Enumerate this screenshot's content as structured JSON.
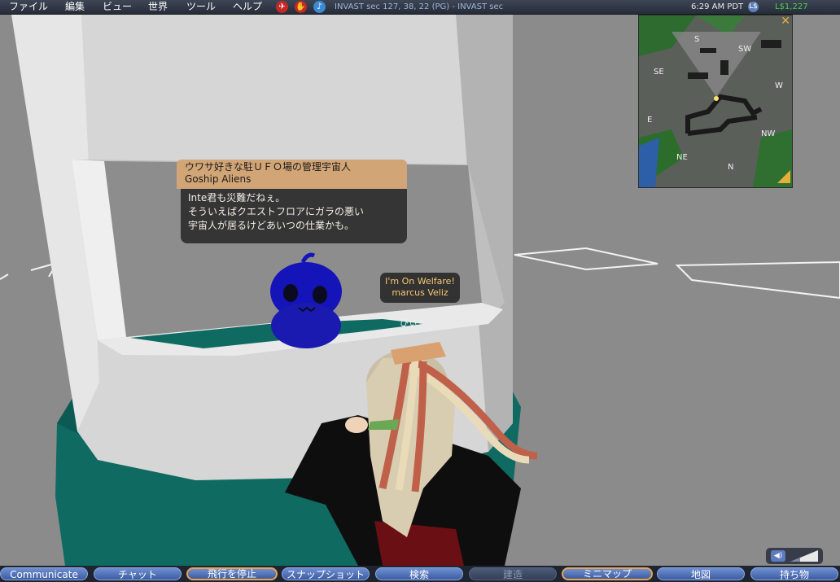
{
  "menubar": {
    "menus": [
      "ファイル",
      "編集",
      "ビュー",
      "世界",
      "ツール",
      "ヘルプ"
    ],
    "location": "INVAST sec 127, 38, 22 (PG) - INVAST sec",
    "time": "6:29 AM PDT",
    "buy_icon": "L$",
    "balance": "L$1,227",
    "status_icons": [
      "no-fly-icon",
      "no-push-icon",
      "voice-icon"
    ]
  },
  "scene": {
    "chat": {
      "title": "ウワサ好きな駐ＵＦＯ場の管理宇宙人",
      "name": "Goship Aliens",
      "lines": [
        "Inte君も災難だねぇ。",
        "そういえばクエストフロアにガラの悪い",
        "宇宙人が居るけどあいつの仕業かも。"
      ]
    },
    "name_tag": {
      "line1": "I'm On Welfare!",
      "line2": "marcus Veliz"
    },
    "avatar_name": "ぴぃ☆"
  },
  "minimap": {
    "directions": {
      "S": "S",
      "SW": "SW",
      "SE": "SE",
      "W": "W",
      "E": "E",
      "NW": "NW",
      "NE": "NE",
      "N": "N"
    },
    "close_label": "✕"
  },
  "toolbar": {
    "buttons": [
      "Communicate",
      "チャット",
      "飛行を停止",
      "スナップショット",
      "検索",
      "建造",
      "ミニマップ",
      "地図",
      "持ち物"
    ]
  },
  "colors": {
    "menubar": "#2c3240",
    "toolbar_button": "#4d6bb3",
    "active_outline": "#e8a450",
    "balance": "#4ad24a"
  }
}
